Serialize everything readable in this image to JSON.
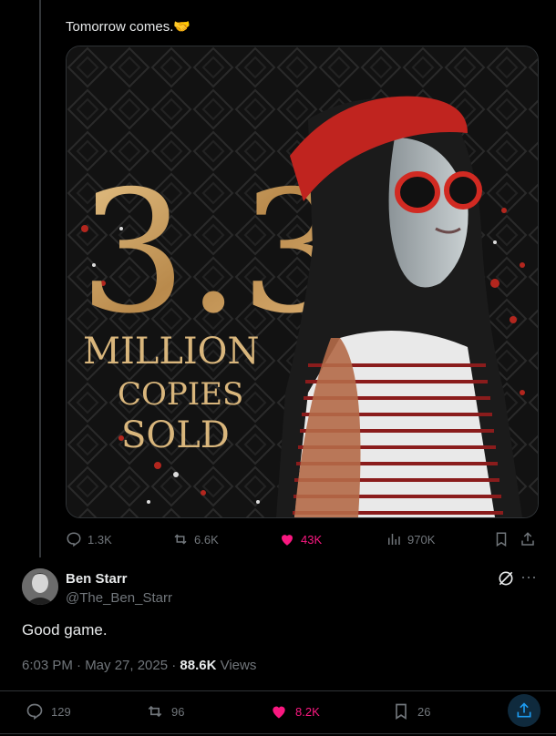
{
  "quoted_post": {
    "text": "Tomorrow comes.",
    "emoji": "🫱🏻‍🫲🏻",
    "image": {
      "big_number": "3.3",
      "line1": "MILLION",
      "line2": "COPIES",
      "line3": "SOLD"
    },
    "actions": {
      "replies": "1.3K",
      "reposts": "6.6K",
      "likes": "43K",
      "views": "970K"
    }
  },
  "post": {
    "author_name": "Ben Starr",
    "author_handle": "@The_Ben_Starr",
    "text": "Good game.",
    "time": "6:03 PM · May 27, 2025 · ",
    "views_count": "88.6K",
    "views_label": " Views",
    "stats": {
      "replies": "129",
      "reposts": "96",
      "likes": "8.2K",
      "bookmarks": "26"
    }
  },
  "colors": {
    "like": "#f91880",
    "muted": "#71767b",
    "accent": "#1d9bf0"
  }
}
